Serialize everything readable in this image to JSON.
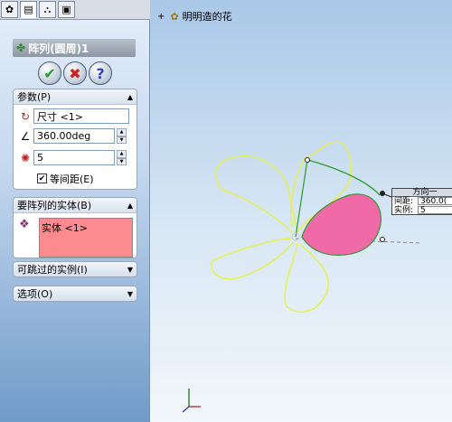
{
  "feature": {
    "title": "阵列(圆周)1",
    "ok_icon": "check-icon",
    "cancel_icon": "x-icon",
    "help_label": "?"
  },
  "parameters": {
    "header": "参数(P)",
    "axis_value": "尺寸 <1>",
    "angle_value": "360.00deg",
    "instances_value": "5",
    "equal_spacing_label": "等间距(E)",
    "equal_spacing_checked": true
  },
  "features_to_pattern": {
    "header": "要阵列的实体(B)",
    "item": "实体 <1>"
  },
  "instances_to_skip": {
    "header": "可跳过的实例(I)"
  },
  "options": {
    "header": "选项(O)"
  },
  "tree": {
    "part_name": "明明造的花"
  },
  "callout": {
    "title": "方向一",
    "spacing_label": "间距:",
    "spacing_value": "360.0(",
    "count_label": "实例:",
    "count_value": "5"
  },
  "colors": {
    "petal_outline": "#e6f050",
    "petal_fill": "#f06aa8",
    "highlight_green": "#2e9a2e",
    "skip_list_color": "#fb8b8f"
  }
}
